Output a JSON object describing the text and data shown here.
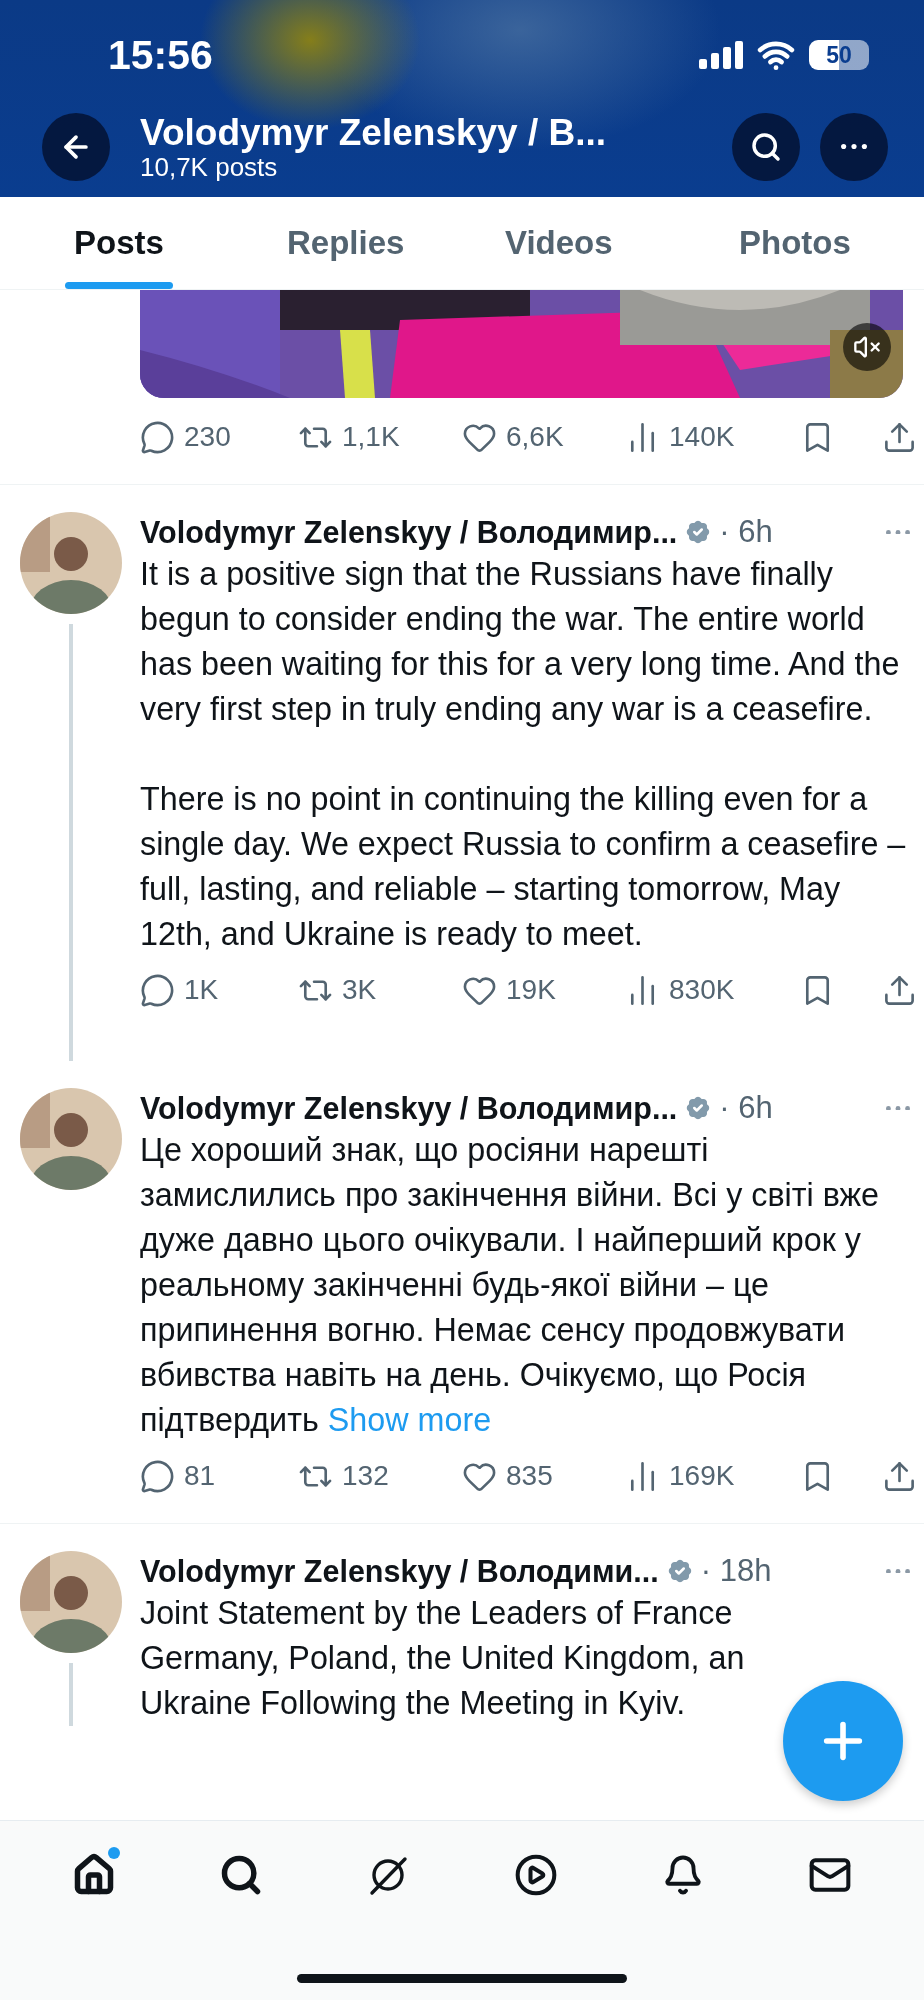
{
  "status_bar": {
    "time": "15:56",
    "battery": "50"
  },
  "header": {
    "title": "Volodymyr Zelenskyy / В...",
    "subtitle": "10,7K posts"
  },
  "tabs": [
    {
      "label": "Posts",
      "selected": true
    },
    {
      "label": "Replies",
      "selected": false
    },
    {
      "label": "Videos",
      "selected": false
    },
    {
      "label": "Photos",
      "selected": false
    }
  ],
  "posts": [
    {
      "kind": "media",
      "media": {
        "kind": "picture",
        "muted": true
      },
      "actions": [
        {
          "kind": "reply",
          "count": "230"
        },
        {
          "kind": "repost",
          "count": "1,1K"
        },
        {
          "kind": "like",
          "count": "6,6K"
        },
        {
          "kind": "views",
          "count": "140K"
        },
        {
          "kind": "bookmark"
        },
        {
          "kind": "share"
        }
      ]
    },
    {
      "kind": "tweet",
      "thread": true,
      "author": "Volodymyr Zelenskyy / Володимир...",
      "verified": true,
      "time": "· 6h",
      "text": "It is a positive sign that the Russians have finally begun to consider ending the war. The entire world has been waiting for this for a very long time. And the very first step in truly ending any war is a ceasefire.\n\nThere is no point in continuing the killing even for a single day. We expect Russia to confirm a ceasefire – full, lasting, and reliable – starting tomorrow, May 12th, and Ukraine is ready to meet.",
      "actions": [
        {
          "kind": "reply",
          "count": "1K"
        },
        {
          "kind": "repost",
          "count": "3K"
        },
        {
          "kind": "like",
          "count": "19K"
        },
        {
          "kind": "views",
          "count": "830K"
        },
        {
          "kind": "bookmark"
        },
        {
          "kind": "share"
        }
      ]
    },
    {
      "kind": "tweet",
      "thread": false,
      "author": "Volodymyr Zelenskyy / Володимир...",
      "verified": true,
      "time": "· 6h",
      "text": "Це хороший знак, що росіяни нарешті замислились про закінчення війни. Всі у світі вже дуже давно цього очікували. І найперший крок у реальному закінченні будь-якої війни – це припинення вогню. Немає сенсу продовжувати вбивства навіть на день. Очікуємо, що Росія підтвердить",
      "show_more": "Show more",
      "actions": [
        {
          "kind": "reply",
          "count": "81"
        },
        {
          "kind": "repost",
          "count": "132"
        },
        {
          "kind": "like",
          "count": "835"
        },
        {
          "kind": "views",
          "count": "169K"
        },
        {
          "kind": "bookmark"
        },
        {
          "kind": "share"
        }
      ]
    },
    {
      "kind": "tweet",
      "thread": true,
      "author": "Volodymyr Zelenskyy / Володими...",
      "verified": true,
      "time": "· 18h",
      "text": "Joint Statement by the Leaders of France\nGermany, Poland, the United Kingdom, an\nUkraine Following the Meeting in Kyiv."
    }
  ],
  "nav": [
    {
      "kind": "home",
      "selected": true,
      "dot": true
    },
    {
      "kind": "search",
      "selected": false,
      "dot": false
    },
    {
      "kind": "grok",
      "selected": false,
      "dot": false
    },
    {
      "kind": "video",
      "selected": false,
      "dot": false
    },
    {
      "kind": "notifications",
      "selected": false,
      "dot": false
    },
    {
      "kind": "messages",
      "selected": false,
      "dot": false
    }
  ]
}
